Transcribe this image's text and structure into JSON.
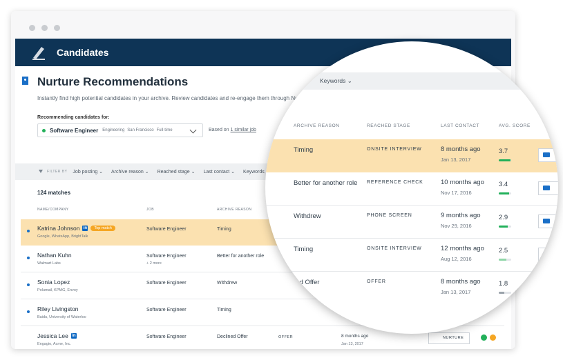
{
  "app": {
    "title": "Candidates"
  },
  "page": {
    "title": "Nurture Recommendations",
    "subtitle": "Instantly find high potential candidates in your archive. Review candidates and re-engage them through Nurture Cam",
    "rec_label": "Recommending candidates for:",
    "job": {
      "title": "Software Engineer",
      "department": "Engineering",
      "location": "San Francisco",
      "type": "Full-time"
    },
    "based_on_prefix": "Based on",
    "based_on_link": "1 similar job"
  },
  "filters": {
    "label": "FILTER BY",
    "chips": [
      "Job posting",
      "Archive reason",
      "Reached stage",
      "Last contact",
      "Keywords"
    ]
  },
  "list": {
    "matches": "124 matches",
    "headers": {
      "name": "NAME/COMPANY",
      "job": "JOB",
      "reason": "ARCHIVE REASON",
      "stage": "REACHED STAGE",
      "last": "LAST CONTACT",
      "score": "AVG. SCORE"
    },
    "badge_top_match": "Top match",
    "rows": [
      {
        "name": "Katrina Johnson",
        "company": "Google, WhatsApp, BrightTalk",
        "job": "Software Engineer",
        "job_extra": "",
        "reason": "Timing",
        "stage": "ONSITE INTERVIEW",
        "last": "8 months ago",
        "date": "Jan 13, 2017",
        "score": "3.7",
        "score_pct": 92
      },
      {
        "name": "Nathan Kuhn",
        "company": "Walmart Labs",
        "job": "Software Engineer",
        "job_extra": "+ 2 more",
        "reason": "Better for another role",
        "stage": "REFERENCE CHECK",
        "last": "10 months ago",
        "date": "Nov 17, 2016",
        "score": "3.4",
        "score_pct": 85
      },
      {
        "name": "Sonia Lopez",
        "company": "Polumail, KPMG, Envoy",
        "job": "Software Engineer",
        "job_extra": "",
        "reason": "Withdrew",
        "stage": "PHONE SCREEN",
        "last": "9 months ago",
        "date": "Nov 29, 2016",
        "score": "2.9",
        "score_pct": 72
      },
      {
        "name": "Riley Livingston",
        "company": "Baidu, University of Waterloo",
        "job": "Software Engineer",
        "job_extra": "",
        "reason": "Timing",
        "stage": "ONSITE INTERVIEW",
        "last": "12 months ago",
        "date": "Aug 12, 2016",
        "score": "2.5",
        "score_pct": 62
      },
      {
        "name": "Jessica Lee",
        "company": "Engagio, Acme, Inc.",
        "job": "Software Engineer",
        "job_extra": "",
        "reason": "Declined Offer",
        "stage": "OFFER",
        "last": "8 months ago",
        "date": "Jan 13, 2017",
        "score": "1.8",
        "score_pct": 45
      }
    ],
    "nurture_label": "NURTURE"
  },
  "lens": {
    "keywords_chip": "Keywords",
    "headers": {
      "reason": "ARCHIVE REASON",
      "stage": "REACHED STAGE",
      "last": "LAST CONTACT",
      "score": "AVG. SCORE"
    },
    "declined_truncated": "clined Offer"
  },
  "colors": {
    "navy": "#0e3456",
    "highlight": "#fbe1b0",
    "accent": "#1a6fc7",
    "green": "#22b05a",
    "orange": "#f5a623"
  }
}
